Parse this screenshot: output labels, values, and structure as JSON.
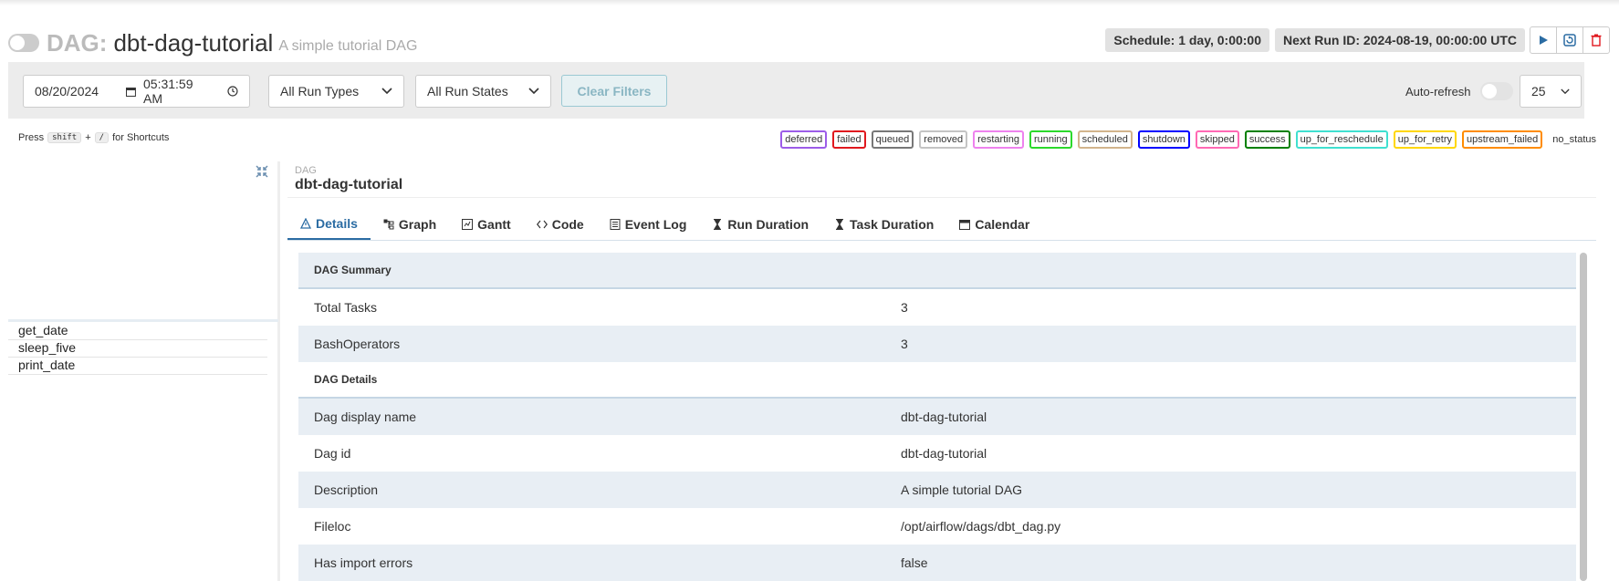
{
  "header": {
    "prefix": "DAG:",
    "dag_id": "dbt-dag-tutorial",
    "description": "A simple tutorial DAG",
    "schedule": "Schedule: 1 day, 0:00:00",
    "next_run": "Next Run ID: 2024-08-19, 00:00:00 UTC"
  },
  "filters": {
    "date": "08/20/2024",
    "time": "05:31:59 AM",
    "run_type": "All Run Types",
    "run_state": "All Run States",
    "clear_label": "Clear Filters",
    "autorefresh_label": "Auto-refresh",
    "num_runs": "25"
  },
  "shortcut": {
    "press": "Press",
    "key1": "shift",
    "plus": "+",
    "key2": "/",
    "suffix": "for Shortcuts"
  },
  "legend": [
    {
      "label": "deferred",
      "color": "#9c5ce8"
    },
    {
      "label": "failed",
      "color": "#e0181e"
    },
    {
      "label": "queued",
      "color": "#777777"
    },
    {
      "label": "removed",
      "color": "#c4c4c4"
    },
    {
      "label": "restarting",
      "color": "#ee82ee"
    },
    {
      "label": "running",
      "color": "#2bd92b"
    },
    {
      "label": "scheduled",
      "color": "#d2b48c"
    },
    {
      "label": "shutdown",
      "color": "#0000ff"
    },
    {
      "label": "skipped",
      "color": "#ff69b4"
    },
    {
      "label": "success",
      "color": "#008000"
    },
    {
      "label": "up_for_reschedule",
      "color": "#40e0d0"
    },
    {
      "label": "up_for_retry",
      "color": "#ffd700"
    },
    {
      "label": "upstream_failed",
      "color": "#ff8c00"
    },
    {
      "label": "no_status",
      "color": ""
    }
  ],
  "tree": {
    "tasks": [
      "get_date",
      "sleep_five",
      "print_date"
    ]
  },
  "main": {
    "label": "DAG",
    "title": "dbt-dag-tutorial",
    "tabs": [
      "Details",
      "Graph",
      "Gantt",
      "Code",
      "Event Log",
      "Run Duration",
      "Task Duration",
      "Calendar"
    ],
    "summary_header": "DAG Summary",
    "summary": [
      {
        "key": "Total Tasks",
        "value": "3"
      },
      {
        "key": "BashOperators",
        "value": "3"
      }
    ],
    "details_header": "DAG Details",
    "details": [
      {
        "key": "Dag display name",
        "value": "dbt-dag-tutorial"
      },
      {
        "key": "Dag id",
        "value": "dbt-dag-tutorial"
      },
      {
        "key": "Description",
        "value": "A simple tutorial DAG"
      },
      {
        "key": "Fileloc",
        "value": "/opt/airflow/dags/dbt_dag.py"
      },
      {
        "key": "Has import errors",
        "value": "false"
      }
    ]
  }
}
